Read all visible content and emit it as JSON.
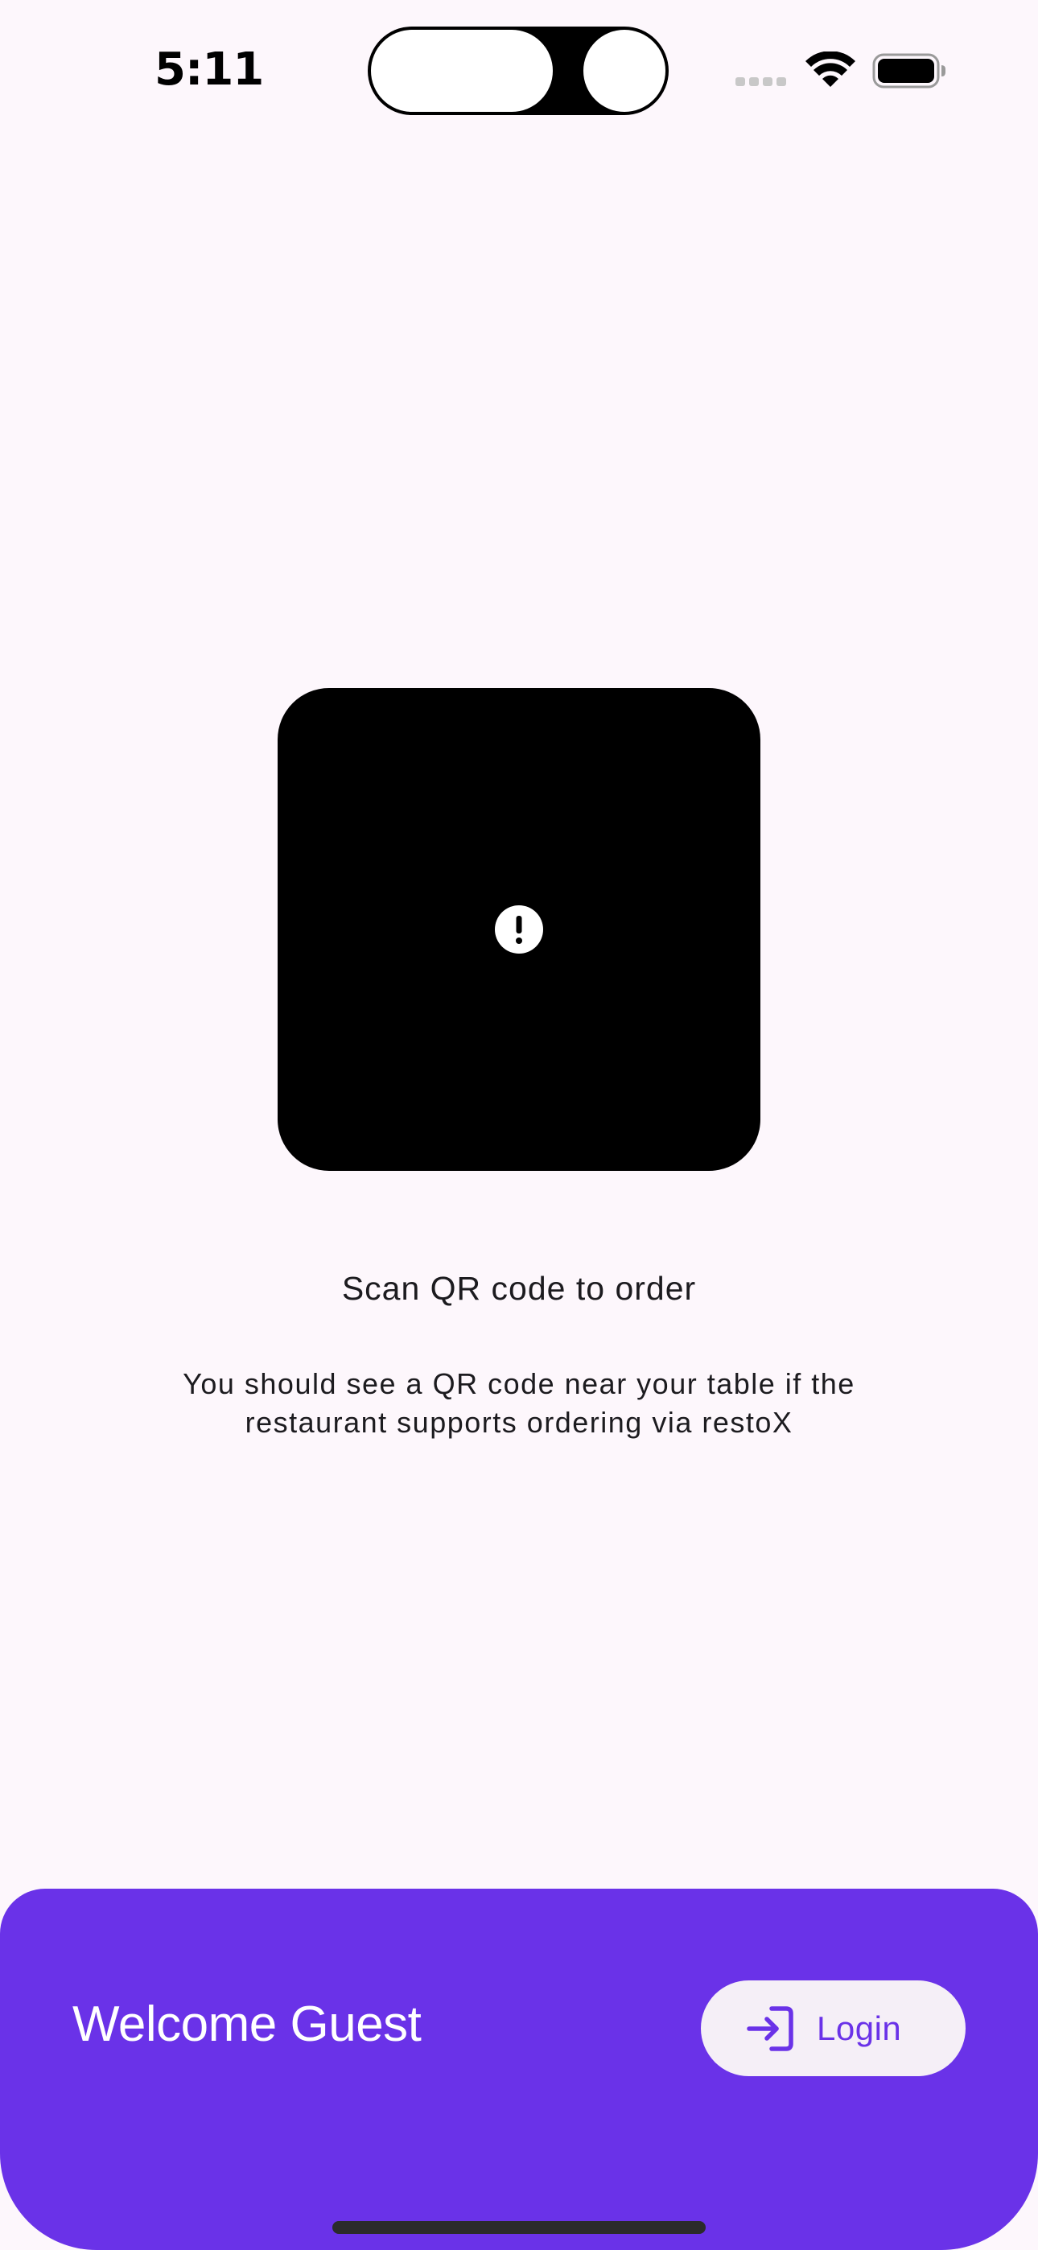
{
  "status_bar": {
    "time": "5:11"
  },
  "scanner": {
    "state_icon": "exclamation-circle-icon",
    "title": "Scan QR code to order",
    "description": "You should see a QR code near your table if the restaurant supports ordering via restoX"
  },
  "footer": {
    "welcome": "Welcome Guest",
    "login_label": "Login",
    "login_icon": "login-arrow-icon"
  },
  "colors": {
    "background": "#fdf7fc",
    "accent": "#6a32e8",
    "button_bg": "#f5eff7"
  }
}
